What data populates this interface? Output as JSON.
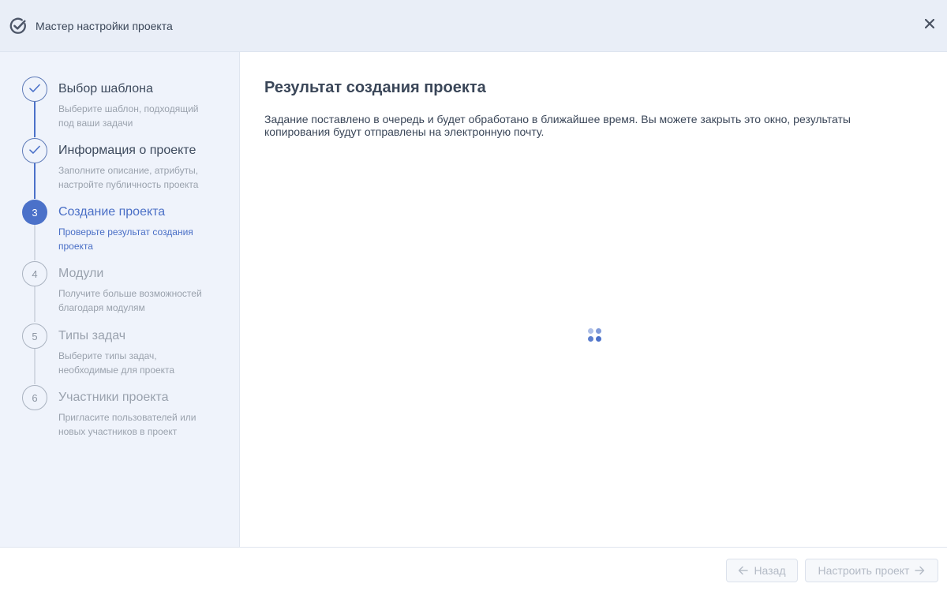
{
  "header": {
    "title": "Мастер настройки проекта",
    "logo_icon": "checkmark-circle-icon",
    "close_icon": "close-icon"
  },
  "steps": [
    {
      "number": "1",
      "title": "Выбор шаблона",
      "description": "Выберите шаблон, подходящий под ваши задачи",
      "status": "done"
    },
    {
      "number": "2",
      "title": "Информация о проекте",
      "description": "Заполните описание, атрибуты, настройте публичность проекта",
      "status": "done"
    },
    {
      "number": "3",
      "title": "Создание проекта",
      "description": "Проверьте результат создания проекта",
      "status": "active"
    },
    {
      "number": "4",
      "title": "Модули",
      "description": "Получите больше возможностей благодаря модулям",
      "status": "pending"
    },
    {
      "number": "5",
      "title": "Типы задач",
      "description": "Выберите типы задач, необходимые для проекта",
      "status": "pending"
    },
    {
      "number": "6",
      "title": "Участники проекта",
      "description": "Пригласите пользователей или новых участников в проект",
      "status": "pending"
    }
  ],
  "content": {
    "title": "Результат создания проекта",
    "message": "Задание поставлено в очередь и будет обработано в ближайшее время. Вы можете закрыть это окно, результаты копирования будут отправлены на электронную почту."
  },
  "footer": {
    "back_label": "Назад",
    "next_label": "Настроить проект",
    "back_icon": "arrow-left-icon",
    "next_icon": "arrow-right-icon"
  },
  "colors": {
    "accent": "#4b71c9",
    "header_bg": "#e9eef7",
    "sidebar_bg": "#eff3fb"
  }
}
